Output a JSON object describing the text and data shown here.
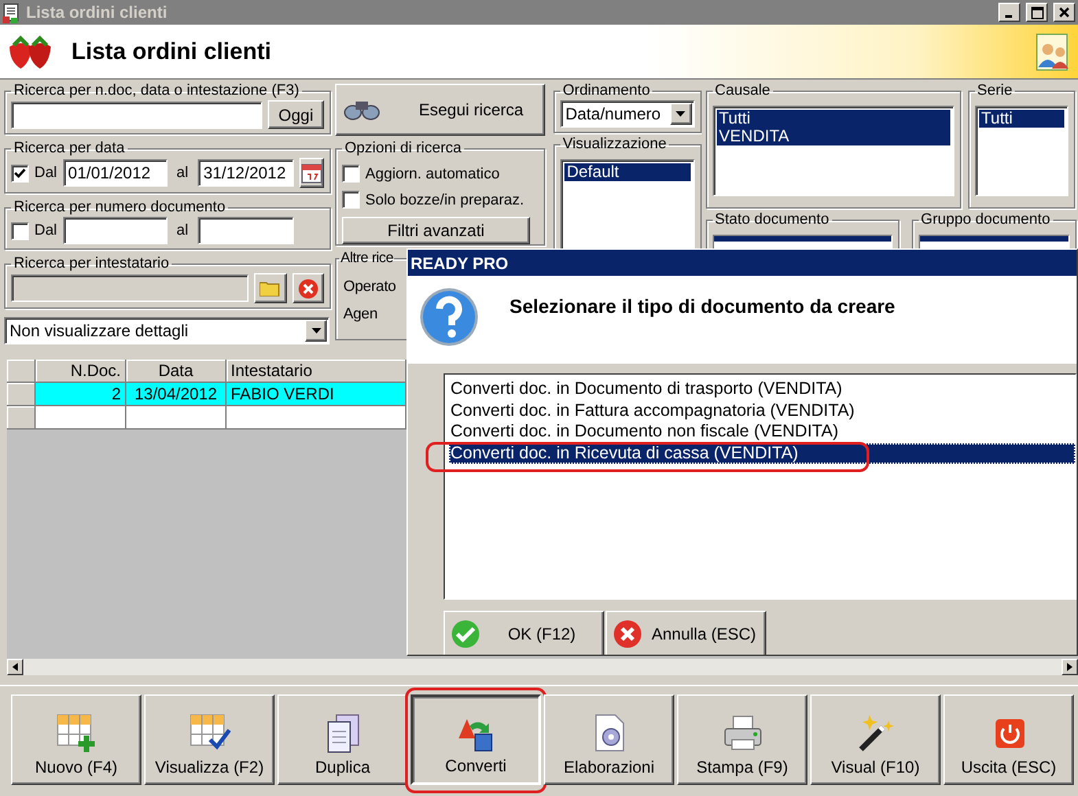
{
  "window": {
    "title": "Lista ordini clienti"
  },
  "header": {
    "title": "Lista ordini clienti"
  },
  "quick_search": {
    "legend": "Ricerca per n.doc, data o intestazione (F3)",
    "button": "Oggi"
  },
  "date_search": {
    "legend": "Ricerca per data",
    "checked": true,
    "from_label": "Dal",
    "from": "01/01/2012",
    "to_label": "al",
    "to": "31/12/2012"
  },
  "number_search": {
    "legend": "Ricerca per numero documento",
    "checked": false,
    "from_label": "Dal",
    "to_label": "al"
  },
  "holder_search": {
    "legend": "Ricerca per intestatario"
  },
  "details_select": {
    "value": "Non visualizzare dettagli"
  },
  "run_search": {
    "label": "Esegui ricerca"
  },
  "search_options": {
    "legend": "Opzioni di ricerca",
    "options": [
      {
        "label": "Aggiorn. automatico",
        "checked": false
      },
      {
        "label": "Solo bozze/in preparaz.",
        "checked": false
      }
    ],
    "button": "Filtri avanzati"
  },
  "other_search": {
    "legend": "Altre rice",
    "fields": [
      "Operato",
      "Agen"
    ]
  },
  "sort": {
    "legend": "Ordinamento",
    "value": "Data/numero"
  },
  "view": {
    "legend": "Visualizzazione",
    "items": [
      {
        "label": "Default",
        "selected": true
      }
    ]
  },
  "reason": {
    "legend": "Causale",
    "items": [
      {
        "label": "Tutti",
        "selected": true
      },
      {
        "label": "VENDITA",
        "selected": true
      }
    ]
  },
  "series": {
    "legend": "Serie",
    "items": [
      {
        "label": "Tutti",
        "selected": true
      }
    ]
  },
  "doc_state": {
    "legend": "Stato documento"
  },
  "doc_group": {
    "legend": "Gruppo documento"
  },
  "table": {
    "columns": [
      "N.Doc.",
      "Data",
      "Intestatario"
    ],
    "rows": [
      {
        "cells": [
          "2",
          "13/04/2012",
          "FABIO VERDI"
        ],
        "selected": true
      }
    ]
  },
  "dialog": {
    "title": "READY PRO",
    "message": "Selezionare il tipo di documento da creare",
    "options": [
      {
        "label": "Converti doc. in Documento di trasporto (VENDITA)",
        "selected": false,
        "highlighted": false
      },
      {
        "label": "Converti doc. in Fattura accompagnatoria (VENDITA)",
        "selected": false,
        "highlighted": false
      },
      {
        "label": "Converti doc. in Documento non fiscale (VENDITA)",
        "selected": false,
        "highlighted": false
      },
      {
        "label": "Converti doc. in Ricevuta di cassa (VENDITA)",
        "selected": true,
        "highlighted": true
      }
    ],
    "buttons": [
      {
        "label": "OK (F12)",
        "kind": "ok"
      },
      {
        "label": "Annulla (ESC)",
        "kind": "cancel"
      }
    ]
  },
  "toolbar": [
    {
      "label": "Nuovo (F4)",
      "kind": "new",
      "highlighted": false
    },
    {
      "label": "Visualizza (F2)",
      "kind": "view",
      "highlighted": false
    },
    {
      "label": "Duplica",
      "kind": "duplicate",
      "highlighted": false
    },
    {
      "label": "Converti",
      "kind": "convert",
      "highlighted": true
    },
    {
      "label": "Elaborazioni",
      "kind": "process",
      "highlighted": false
    },
    {
      "label": "Stampa (F9)",
      "kind": "print",
      "highlighted": false
    },
    {
      "label": "Visual (F10)",
      "kind": "visual",
      "highlighted": false
    },
    {
      "label": "Uscita (ESC)",
      "kind": "exit",
      "highlighted": false
    }
  ]
}
